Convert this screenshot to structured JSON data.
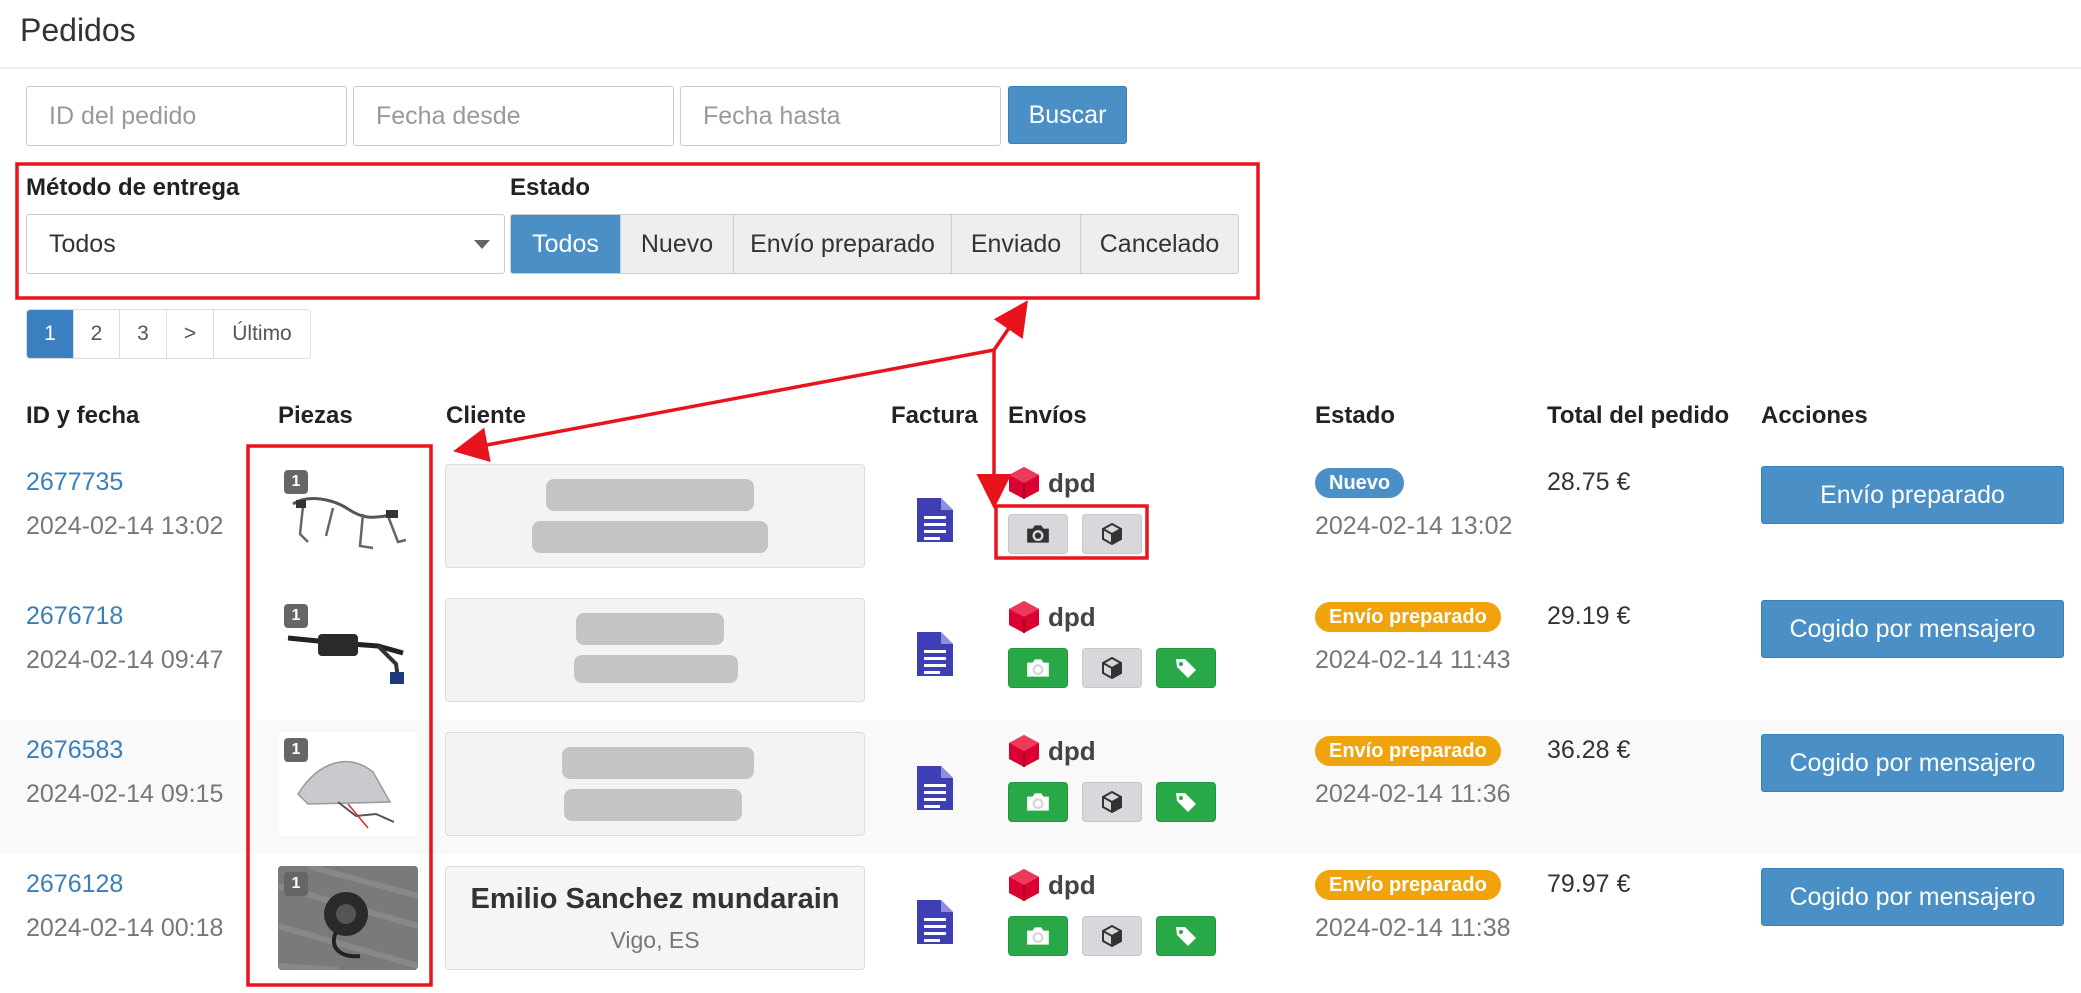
{
  "page": {
    "title": "Pedidos"
  },
  "search": {
    "order_id_placeholder": "ID del pedido",
    "date_from_placeholder": "Fecha desde",
    "date_to_placeholder": "Fecha hasta",
    "button": "Buscar"
  },
  "filters": {
    "delivery_label": "Método de entrega",
    "delivery_value": "Todos",
    "status_label": "Estado",
    "status_options": [
      "Todos",
      "Nuevo",
      "Envío preparado",
      "Enviado",
      "Cancelado"
    ],
    "status_selected": "Todos"
  },
  "pagination": {
    "pages": [
      "1",
      "2",
      "3",
      ">",
      "Último"
    ],
    "current": "1"
  },
  "table": {
    "headers": {
      "id_date": "ID y fecha",
      "parts": "Piezas",
      "client": "Cliente",
      "invoice": "Factura",
      "shipments": "Envíos",
      "status": "Estado",
      "total": "Total del pedido",
      "actions": "Acciones"
    },
    "rows": [
      {
        "id": "2677735",
        "date": "2024-02-14 13:02",
        "qty": "1",
        "client_name": "",
        "client_location": "",
        "carrier": "dpd",
        "shipment_buttons": [
          "camera-icon",
          "box-icon"
        ],
        "status": "Nuevo",
        "status_date": "2024-02-14 13:02",
        "total": "28.75 €",
        "action": "Envío preparado"
      },
      {
        "id": "2676718",
        "date": "2024-02-14 09:47",
        "qty": "1",
        "client_name": "",
        "client_location": "",
        "carrier": "dpd",
        "shipment_buttons": [
          "camera-icon",
          "box-icon",
          "tag-icon"
        ],
        "status": "Envío preparado",
        "status_date": "2024-02-14 11:43",
        "total": "29.19 €",
        "action": "Cogido por mensajero"
      },
      {
        "id": "2676583",
        "date": "2024-02-14 09:15",
        "qty": "1",
        "client_name": "",
        "client_location": "",
        "carrier": "dpd",
        "shipment_buttons": [
          "camera-icon",
          "box-icon",
          "tag-icon"
        ],
        "status": "Envío preparado",
        "status_date": "2024-02-14 11:36",
        "total": "36.28 €",
        "action": "Cogido por mensajero"
      },
      {
        "id": "2676128",
        "date": "2024-02-14 00:18",
        "qty": "1",
        "client_name": "Emilio Sanchez mundarain",
        "client_location": "Vigo, ES",
        "carrier": "dpd",
        "shipment_buttons": [
          "camera-icon",
          "box-icon",
          "tag-icon"
        ],
        "status": "Envío preparado",
        "status_date": "2024-02-14 11:38",
        "total": "79.97 €",
        "action": "Cogido por mensajero"
      }
    ]
  },
  "colors": {
    "primary": "#4a90c6",
    "success": "#29a848",
    "warning": "#f0a30a",
    "annotation": "#e8141c",
    "dpd": "#dc0032"
  }
}
